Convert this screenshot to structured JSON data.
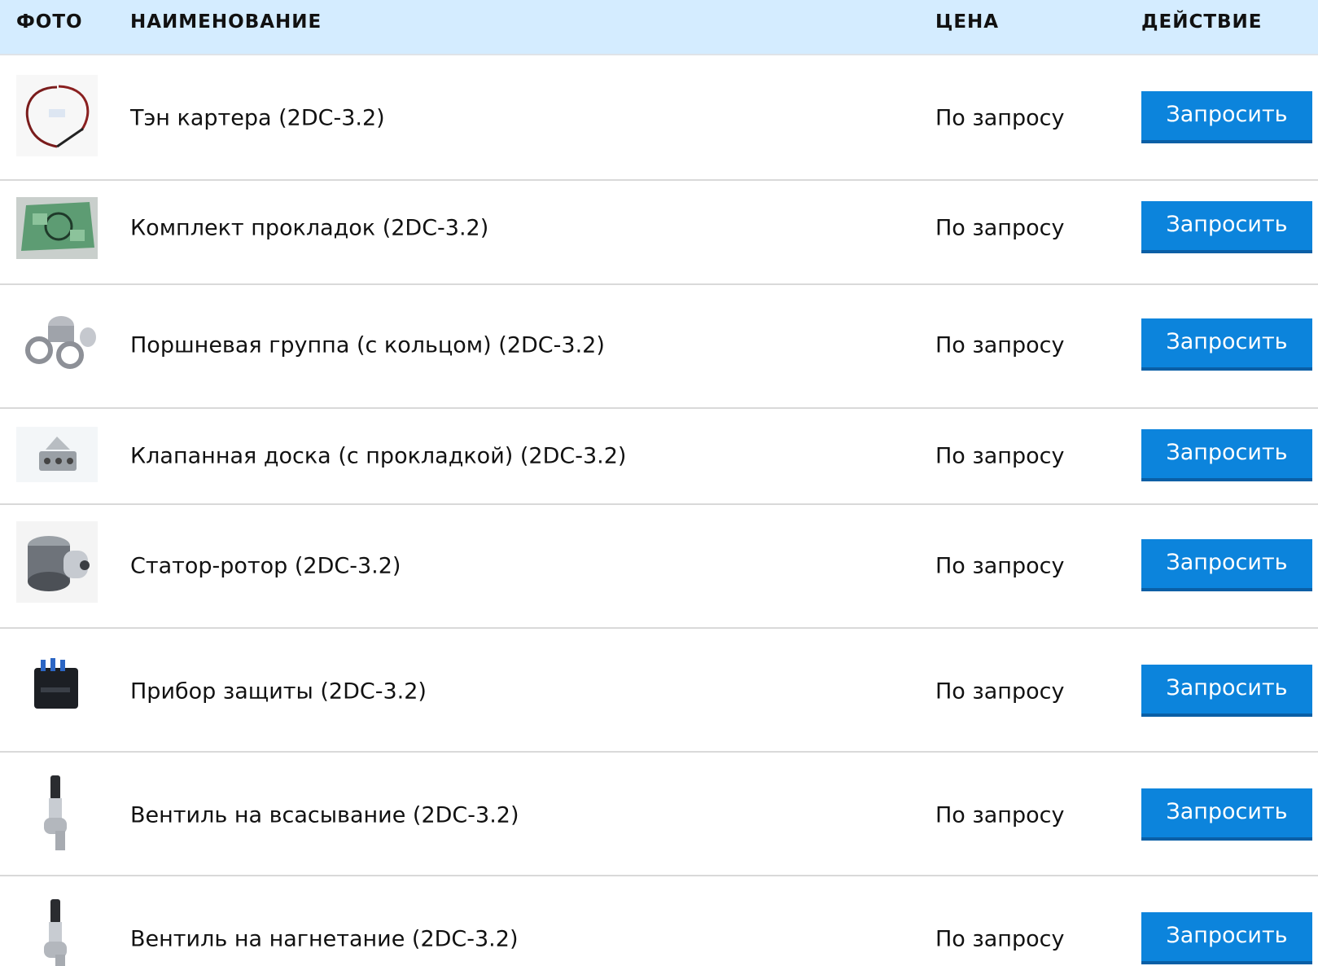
{
  "header": {
    "photo": "ФОТО",
    "name": "НАИМЕНОВАНИЕ",
    "price": "ЦЕНА",
    "action": "ДЕЙСТВИЕ"
  },
  "rows": [
    {
      "name": "Тэн картера (2DC-3.2)",
      "price": "По запросу",
      "button": "Запросить",
      "photo_icon": "crankcase-heater-icon"
    },
    {
      "name": "Комплект прокладок (2DC-3.2)",
      "price": "По запросу",
      "button": "Запросить",
      "photo_icon": "gasket-kit-icon"
    },
    {
      "name": "Поршневая группа (с кольцом) (2DC-3.2)",
      "price": "По запросу",
      "button": "Запросить",
      "photo_icon": "piston-group-icon"
    },
    {
      "name": "Клапанная доска (с прокладкой) (2DC-3.2)",
      "price": "По запросу",
      "button": "Запросить",
      "photo_icon": "valve-plate-icon"
    },
    {
      "name": "Статор-ротор (2DC-3.2)",
      "price": "По запросу",
      "button": "Запросить",
      "photo_icon": "stator-rotor-icon"
    },
    {
      "name": "Прибор защиты (2DC-3.2)",
      "price": "По запросу",
      "button": "Запросить",
      "photo_icon": "protection-device-icon"
    },
    {
      "name": "Вентиль на всасывание (2DC-3.2)",
      "price": "По запросу",
      "button": "Запросить",
      "photo_icon": "suction-valve-icon"
    },
    {
      "name": "Вентиль на нагнетание (2DC-3.2)",
      "price": "По запросу",
      "button": "Запросить",
      "photo_icon": "discharge-valve-icon"
    }
  ],
  "colors": {
    "header_bg": "#d4ecff",
    "button_bg": "#0c84dc",
    "button_text": "#ffffff"
  }
}
